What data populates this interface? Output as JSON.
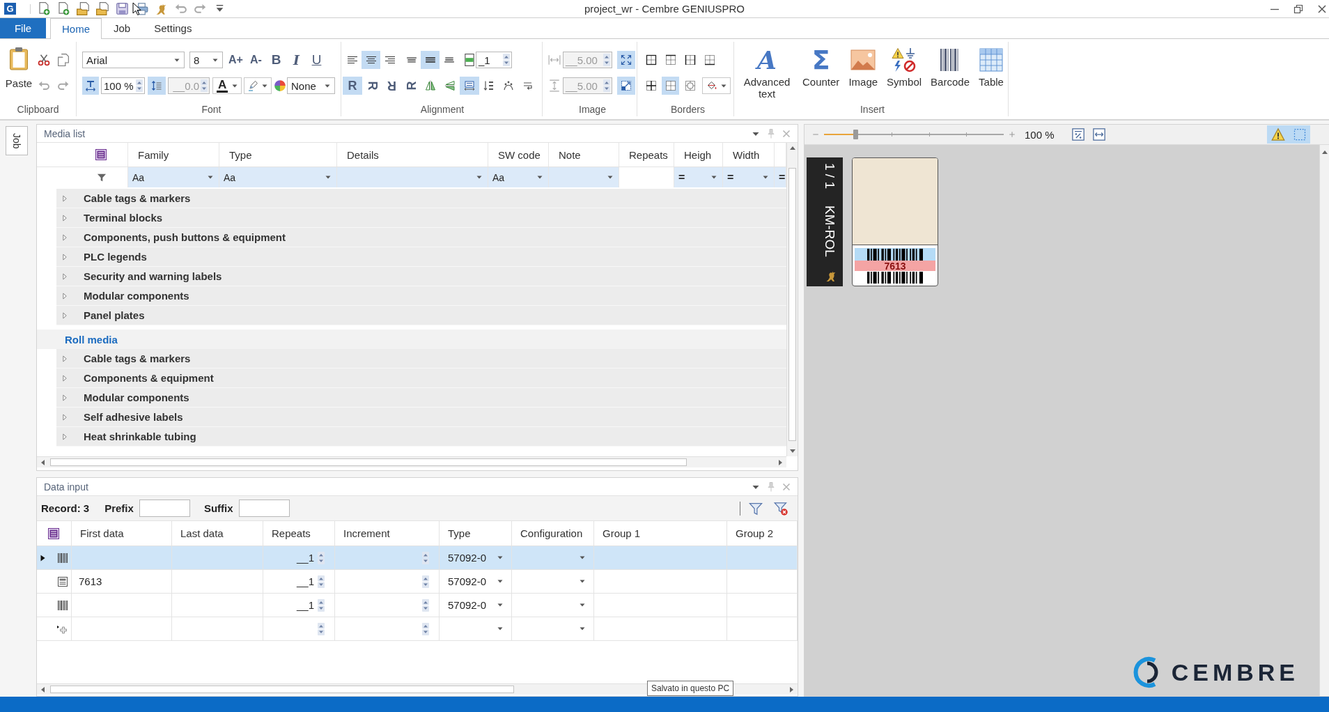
{
  "window": {
    "logo": "G",
    "title": "project_wr - Cembre GENIUSPRO"
  },
  "ribbon_tabs": [
    {
      "label": "File",
      "kind": "backstage",
      "selected": false
    },
    {
      "label": "Home",
      "kind": "tab",
      "selected": true
    },
    {
      "label": "Job",
      "kind": "tab",
      "selected": false
    },
    {
      "label": "Settings",
      "kind": "tab",
      "selected": false
    }
  ],
  "ribbon": {
    "clipboard": {
      "label": "Clipboard",
      "paste": "Paste"
    },
    "font": {
      "label": "Font",
      "family": "Arial",
      "size": "8",
      "styles": [
        {
          "kind": "grow",
          "glyph": "A+",
          "selected": false
        },
        {
          "kind": "shrink",
          "glyph": "A-",
          "selected": false
        },
        {
          "kind": "bold",
          "glyph": "B",
          "selected": false
        },
        {
          "kind": "italic",
          "glyph": "I",
          "selected": false
        },
        {
          "kind": "underline",
          "glyph": "U",
          "selected": false
        }
      ],
      "fit": {
        "selected": true
      },
      "scale": {
        "value": "100 %",
        "disabled": false
      },
      "spacing_mode": {
        "selected": true
      },
      "spacing": {
        "value": "__0.0",
        "disabled": true
      },
      "color_glyph": "A",
      "fill": "None"
    },
    "alignment": {
      "label": "Alignment",
      "horizontal": [
        {
          "kind": "left",
          "selected": false
        },
        {
          "kind": "center",
          "selected": true
        },
        {
          "kind": "right",
          "selected": false
        }
      ],
      "vertical": [
        {
          "kind": "top",
          "selected": false
        },
        {
          "kind": "middle",
          "selected": true
        },
        {
          "kind": "bottom",
          "selected": false
        }
      ],
      "lines": {
        "value": "_1",
        "disabled": false
      },
      "rotation": [
        {
          "kind": "upright",
          "glyph": "R",
          "selected": true
        },
        {
          "kind": "quarter",
          "glyph": "R",
          "selected": false
        },
        {
          "kind": "half",
          "glyph": "R",
          "selected": false
        },
        {
          "kind": "threequarter",
          "glyph": "R",
          "selected": false
        }
      ],
      "tools": [
        {
          "kind": "mirror",
          "selected": false
        },
        {
          "kind": "flip",
          "selected": false
        },
        {
          "kind": "fit",
          "selected": true
        },
        {
          "kind": "stack",
          "selected": false
        },
        {
          "kind": "curve",
          "selected": false
        },
        {
          "kind": "wrap",
          "selected": false
        }
      ]
    },
    "image": {
      "label": "Image",
      "width": {
        "value": "__5.00",
        "disabled": true
      },
      "height": {
        "value": "__5.00",
        "disabled": true
      },
      "stretch": {
        "selected": true
      },
      "proportional": {
        "selected": true
      }
    },
    "borders": {
      "label": "Borders",
      "styles": [
        {
          "kind": "outer",
          "selected": false
        },
        {
          "kind": "top",
          "selected": false
        },
        {
          "kind": "sides",
          "selected": false
        },
        {
          "kind": "bottom",
          "selected": false
        },
        {
          "kind": "grid",
          "selected": false
        },
        {
          "kind": "inner",
          "selected": true
        },
        {
          "kind": "rounded",
          "selected": false
        }
      ]
    },
    "insert": {
      "label": "Insert",
      "items": [
        {
          "kind": "text",
          "glyph": "A",
          "label": "Advanced text"
        },
        {
          "kind": "counter",
          "glyph": "Σ",
          "label": "Counter"
        },
        {
          "kind": "image",
          "label": "Image"
        },
        {
          "kind": "symbol",
          "label": "Symbol"
        },
        {
          "kind": "barcode",
          "label": "Barcode"
        },
        {
          "kind": "table",
          "label": "Table"
        }
      ]
    }
  },
  "side_tab": "Job",
  "media_list": {
    "title": "Media list",
    "columns": [
      "Family",
      "Type",
      "Details",
      "SW code",
      "Note",
      "Repeats",
      "Heigh",
      "Width"
    ],
    "filters": [
      {
        "kind": "text",
        "label": "Aa"
      },
      {
        "kind": "text",
        "label": "Aa"
      },
      {
        "kind": "list"
      },
      {
        "kind": "text",
        "label": "Aa"
      },
      {
        "kind": "list"
      },
      {
        "kind": "input"
      },
      {
        "kind": "equals",
        "label": "="
      },
      {
        "kind": "equals",
        "label": "="
      },
      {
        "kind": "equals",
        "label": "="
      }
    ],
    "sections": [
      {
        "items": [
          {
            "label": "Cable tags & markers",
            "expanded": false
          },
          {
            "label": "Terminal blocks",
            "expanded": false
          },
          {
            "label": "Components, push buttons & equipment",
            "expanded": false
          },
          {
            "label": "PLC legends",
            "expanded": false
          },
          {
            "label": "Security and warning labels",
            "expanded": false
          },
          {
            "label": "Modular components",
            "expanded": false
          },
          {
            "label": "Panel plates",
            "expanded": false
          }
        ]
      },
      {
        "heading": "Roll media",
        "items": [
          {
            "label": "Cable tags & markers",
            "expanded": false
          },
          {
            "label": "Components & equipment",
            "expanded": false
          },
          {
            "label": "Modular components",
            "expanded": false
          },
          {
            "label": "Self adhesive labels",
            "expanded": false
          },
          {
            "label": "Heat shrinkable tubing",
            "expanded": false
          }
        ]
      }
    ]
  },
  "data_input": {
    "title": "Data input",
    "record": "Record: 3",
    "prefix_label": "Prefix",
    "suffix_label": "Suffix",
    "columns": [
      "First data",
      "Last data",
      "Repeats",
      "Increment",
      "Type",
      "Configuration",
      "Group 1",
      "Group 2"
    ],
    "rows": [
      {
        "kind": "barcode",
        "selected": true,
        "repeats": "__1",
        "type": "57092-0"
      },
      {
        "kind": "text",
        "selected": false,
        "first_data": "7613",
        "repeats": "__1",
        "type": "57092-0"
      },
      {
        "kind": "barcode",
        "selected": false,
        "repeats": "__1",
        "type": "57092-0"
      },
      {
        "kind": "new",
        "selected": false
      }
    ]
  },
  "preview": {
    "zoom": {
      "level": 0.175,
      "reading": "100 %"
    },
    "toggles": [
      {
        "kind": "warning",
        "selected": true
      },
      {
        "kind": "frame",
        "selected": true
      }
    ],
    "page": "1 / 1",
    "media": "KM-ROL",
    "fields": [
      {
        "kind": "barcode",
        "color": "#b5dbf6"
      },
      {
        "kind": "text",
        "text": "7613",
        "color": "#f4a4a4"
      },
      {
        "kind": "barcode"
      }
    ]
  },
  "brand": "CEMBRE",
  "tooltip": "Salvato in questo PC"
}
